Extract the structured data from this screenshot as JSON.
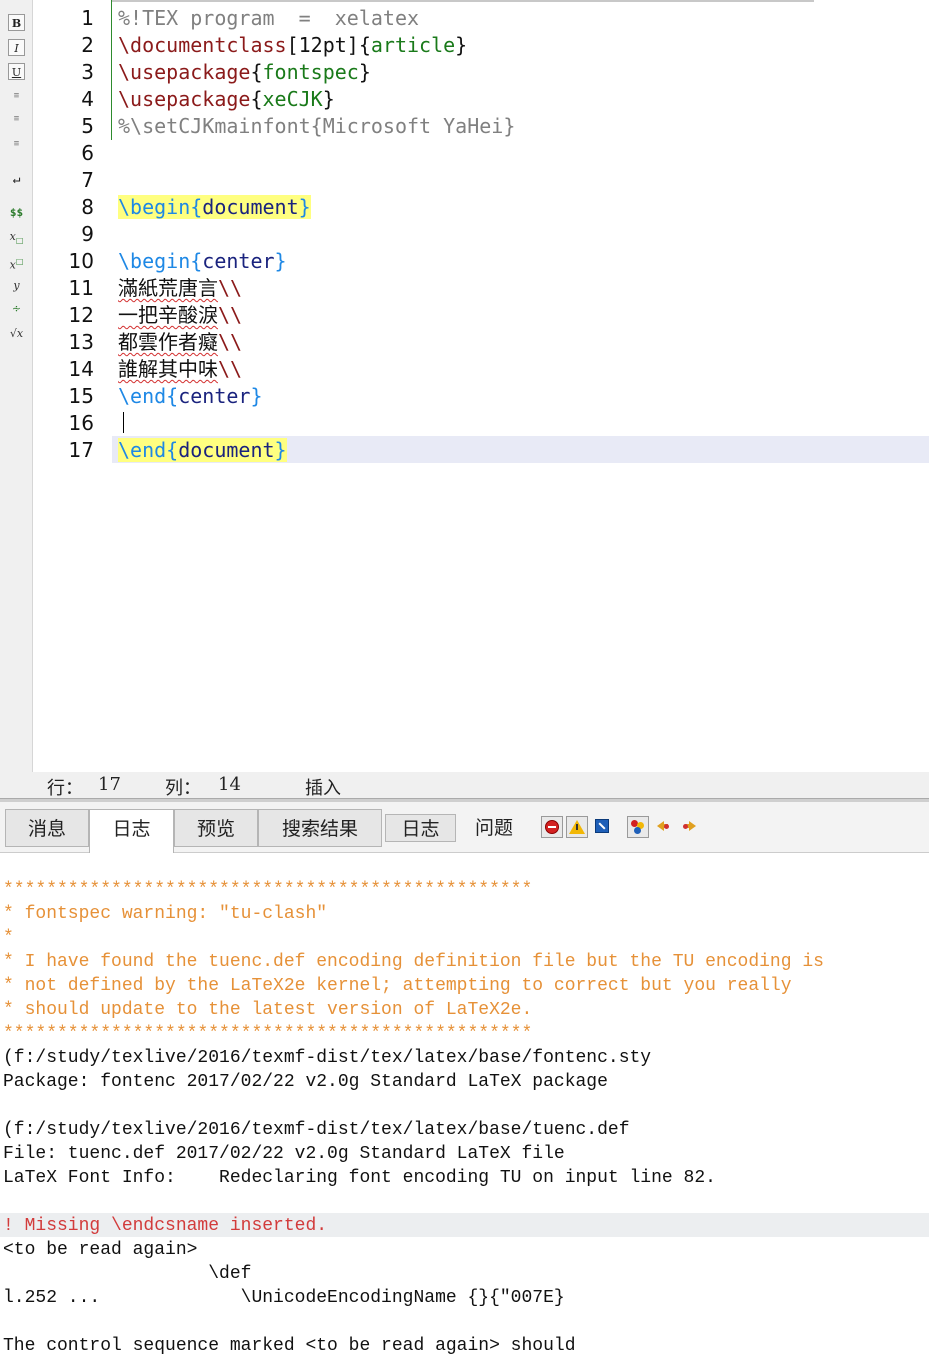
{
  "toolbar": {
    "bold_label": "B",
    "italic_label": "I",
    "underline_label": "U",
    "math_label": "$$",
    "subscript_label": "x",
    "superscript_label": "x",
    "frac_label": "y",
    "sqrt_label": "√x"
  },
  "editor": {
    "line_numbers": [
      "1",
      "2",
      "3",
      "4",
      "5",
      "6",
      "7",
      "8",
      "9",
      "10",
      "11",
      "12",
      "13",
      "14",
      "15",
      "16",
      "17"
    ],
    "l1": "%!TEX program  =  xelatex",
    "l2_cmd": "\\documentclass",
    "l2_opt": "[12pt]{",
    "l2_arg": "article",
    "l2_close": "}",
    "l3_cmd": "\\usepackage",
    "l3_open": "{",
    "l3_arg": "fontspec",
    "l3_close": "}",
    "l4_cmd": "\\usepackage",
    "l4_open": "{",
    "l4_arg": "xeCJK",
    "l4_close": "}",
    "l5": "%\\setCJKmainfont{Microsoft YaHei}",
    "l8_begin": "\\begin",
    "l8_open": "{",
    "l8_name": "document",
    "l8_close": "}",
    "l10_begin": "\\begin",
    "l10_open": "{",
    "l10_name": "center",
    "l10_close": "}",
    "l11_text": "滿紙荒唐言",
    "l12_text": "一把辛酸淚",
    "l13_text": "都雲作者癡",
    "l14_text": "誰解其中味",
    "linebreak": "\\\\",
    "l15_end": "\\end",
    "l15_open": "{",
    "l15_name": "center",
    "l15_close": "}",
    "l17_end": "\\end",
    "l17_open": "{",
    "l17_name": "document",
    "l17_close": "}"
  },
  "status": {
    "row_label": "行：",
    "row_value": "17",
    "col_label": "列：",
    "col_value": "14",
    "mode": "插入"
  },
  "tabs": [
    "消息",
    "日志",
    "预览",
    "搜索结果",
    "日志",
    "问题"
  ],
  "log": {
    "stars": "*************************************************",
    "w1": "* fontspec warning: \"tu-clash\"",
    "w2": "*",
    "w3": "* I have found the tuenc.def encoding definition file but the TU encoding is",
    "w4": "* not defined by the LaTeX2e kernel; attempting to correct but you really",
    "w5": "* should update to the latest version of LaTeX2e.",
    "p1": "(f:/study/texlive/2016/texmf-dist/tex/latex/base/fontenc.sty",
    "p2": "Package: fontenc 2017/02/22 v2.0g Standard LaTeX package",
    "p3": "(f:/study/texlive/2016/texmf-dist/tex/latex/base/tuenc.def",
    "p4": "File: tuenc.def 2017/02/22 v2.0g Standard LaTeX file",
    "p5": "LaTeX Font Info:    Redeclaring font encoding TU on input line 82.",
    "e1": "! Missing \\endcsname inserted.",
    "e2": "<to be read again>",
    "e3": "                   \\def",
    "e4": "l.252 ...             \\UnicodeEncodingName {}{\"007E}",
    "e5": "The control sequence marked <to be read again> should"
  }
}
